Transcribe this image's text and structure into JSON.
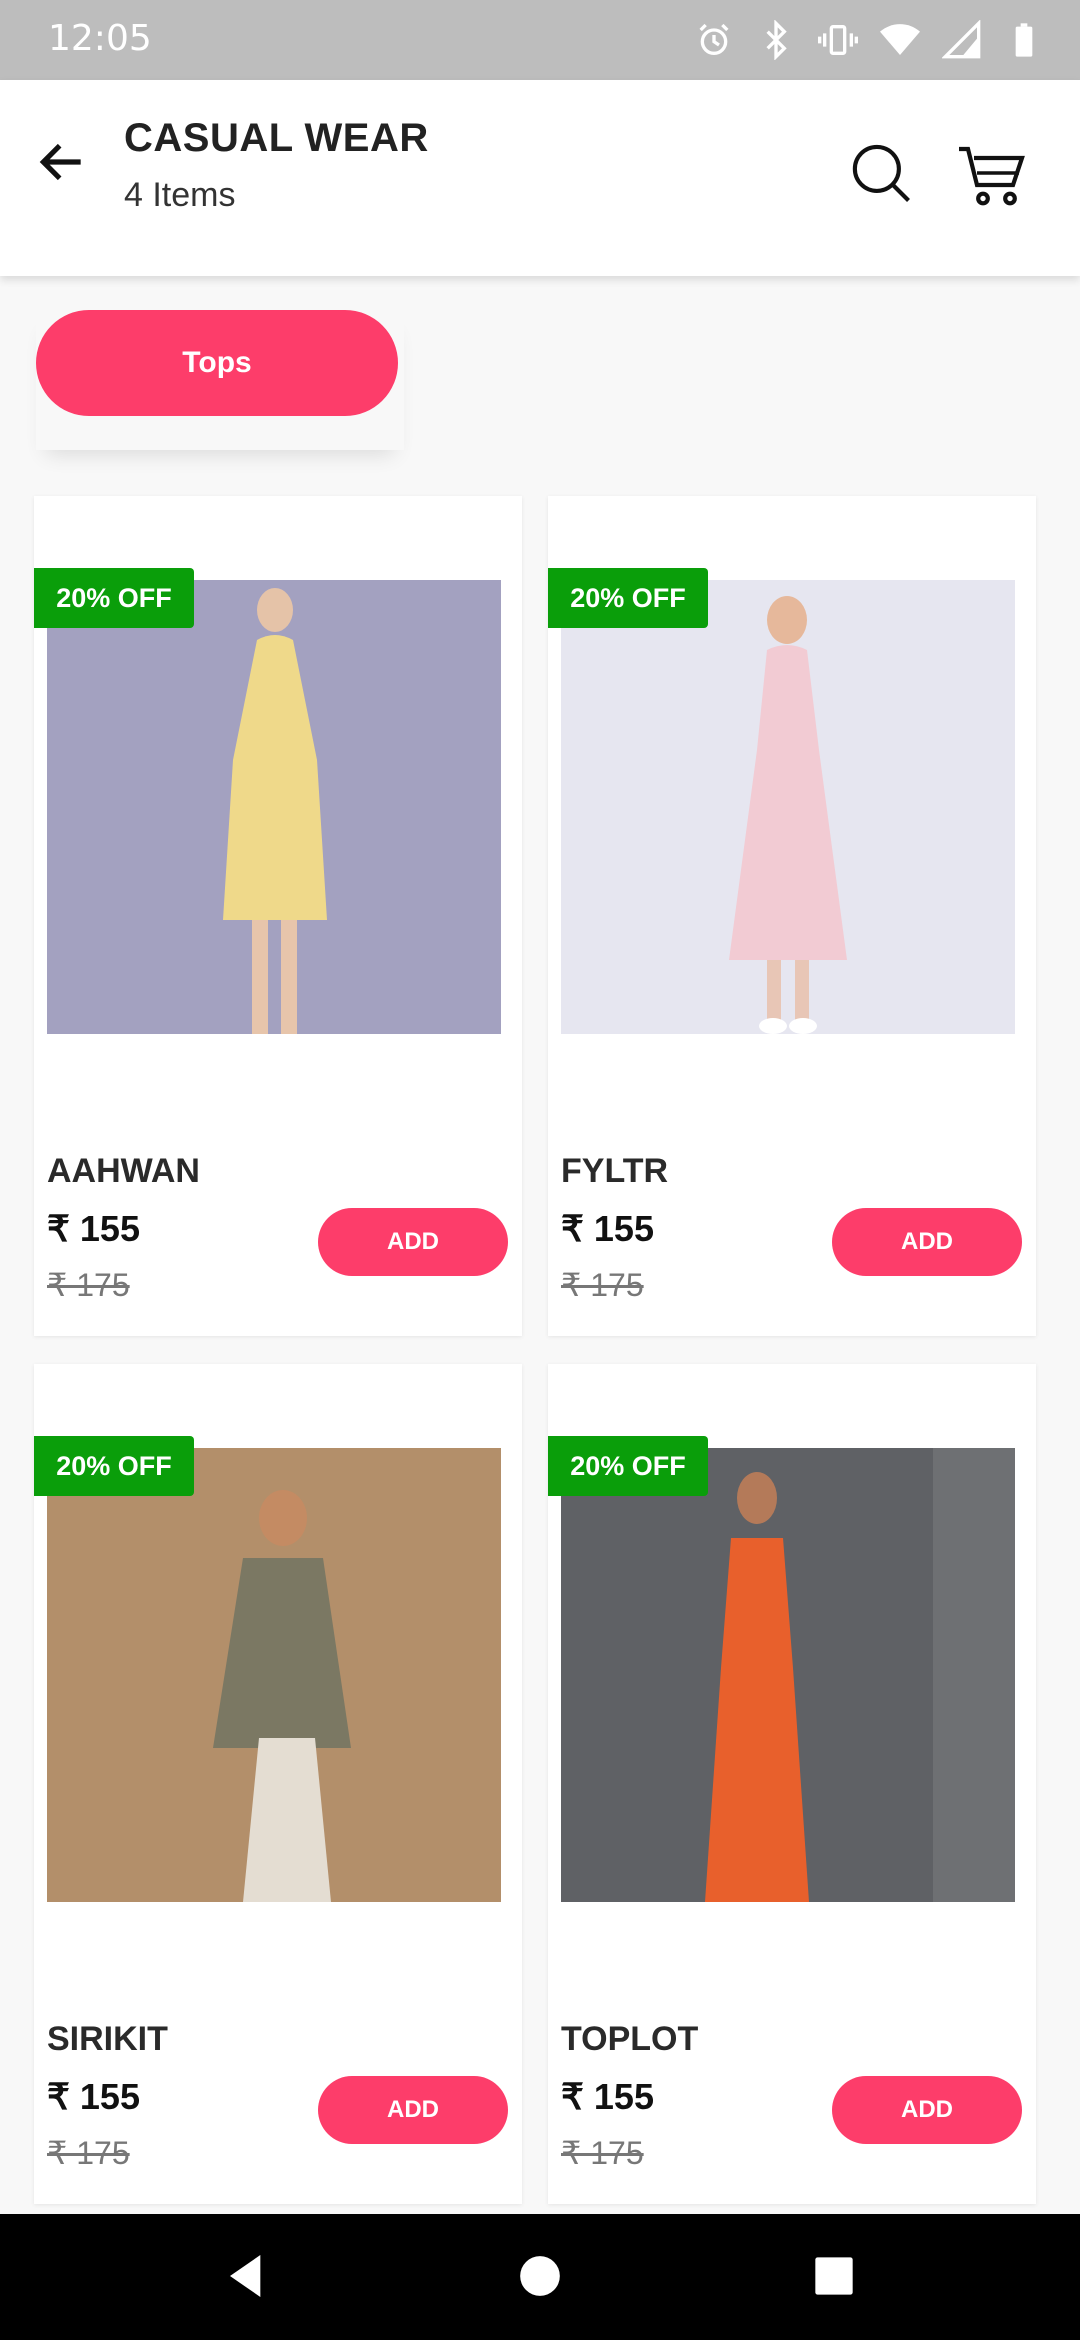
{
  "status_bar": {
    "time": "12:05",
    "icons": [
      "alarm-icon",
      "bluetooth-icon",
      "vibrate-icon",
      "wifi-icon",
      "signal-icon",
      "battery-icon"
    ]
  },
  "header": {
    "title": "CASUAL WEAR",
    "item_count": "4 Items"
  },
  "filters": {
    "chips": [
      "Tops"
    ]
  },
  "products": [
    {
      "name": "AAHWAN",
      "price": "₹ 155",
      "mrp": "₹ 175",
      "badge": "20% OFF",
      "add_label": "ADD",
      "bg_color": "#a3a1c0"
    },
    {
      "name": "FYLTR",
      "price": "₹ 155",
      "mrp": "₹ 175",
      "badge": "20% OFF",
      "add_label": "ADD",
      "bg_color": "#e6e6f0"
    },
    {
      "name": "SIRIKIT",
      "price": "₹ 155",
      "mrp": "₹ 175",
      "badge": "20% OFF",
      "add_label": "ADD",
      "bg_color": "#b38f6a"
    },
    {
      "name": "TOPLOT",
      "price": "₹ 155",
      "mrp": "₹ 175",
      "badge": "20% OFF",
      "add_label": "ADD",
      "bg_color": "#5f6165"
    }
  ],
  "colors": {
    "accent": "#fd3d6a",
    "badge": "#0a9e0a"
  }
}
